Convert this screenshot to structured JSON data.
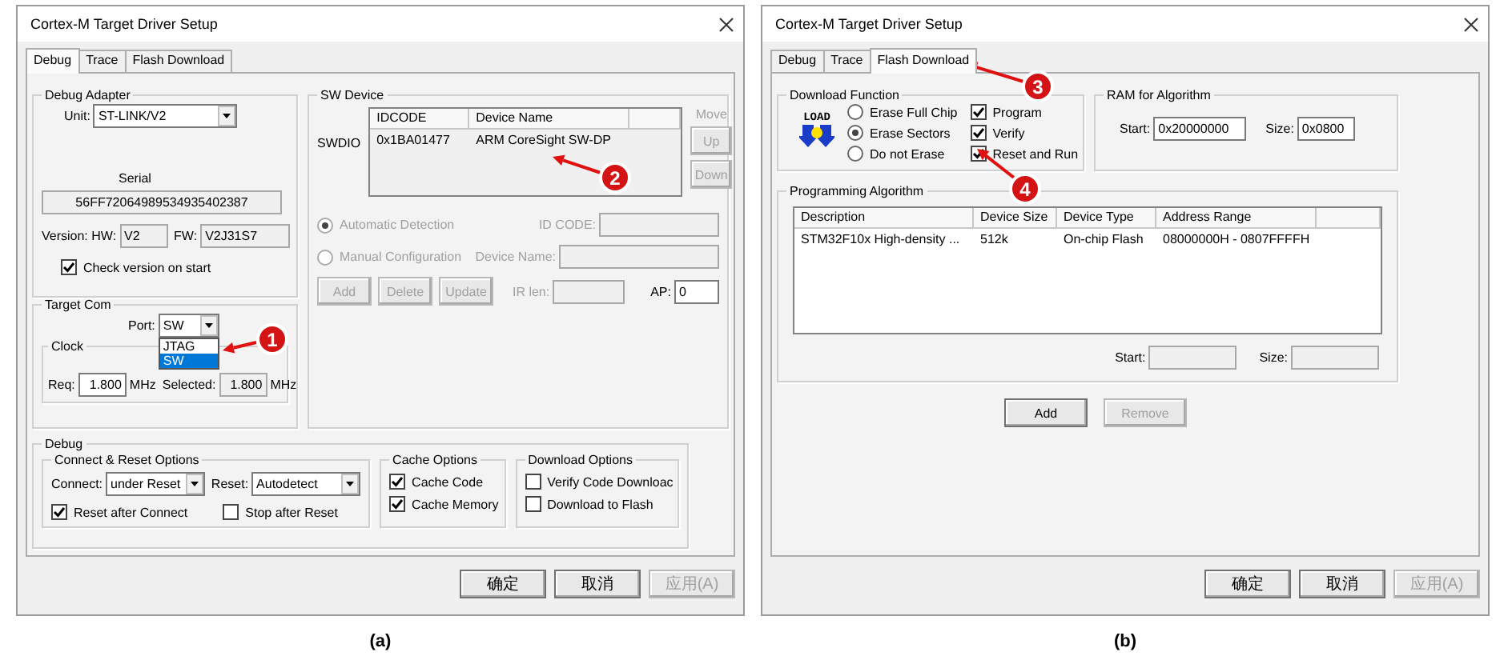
{
  "dialogs": [
    {
      "kind": "debug",
      "title": "Cortex-M Target Driver Setup",
      "caption": "(a)",
      "tabs": [
        {
          "label": "Debug",
          "selected": true
        },
        {
          "label": "Trace",
          "selected": false
        },
        {
          "label": "Flash Download",
          "selected": false
        }
      ],
      "debug_adapter": {
        "title": "Debug Adapter",
        "unit_label": "Unit:",
        "unit": "ST-LINK/V2",
        "serial_label": "Serial",
        "serial": {
          "value": "56FF72064989534935402387",
          "disabled": true
        },
        "version_label": "Version: HW:",
        "hw": {
          "value": "V2",
          "disabled": true
        },
        "fw_label": "FW:",
        "fw": {
          "value": "V2J31S7",
          "disabled": true
        },
        "check_version": {
          "label": "Check version on start",
          "checked": true
        }
      },
      "sw_device": {
        "title": "SW Device",
        "row_label": "SWDIO",
        "columns": [
          "IDCODE",
          "Device Name"
        ],
        "rows": [
          [
            "0x1BA01477",
            "ARM CoreSight SW-DP"
          ]
        ],
        "move_label": "Move",
        "move_buttons": [
          {
            "label": "Up",
            "disabled": true
          },
          {
            "label": "Down",
            "disabled": true
          }
        ],
        "modes": [
          {
            "label": "Automatic Detection",
            "selected": true,
            "disabled": true
          },
          {
            "label": "Manual Configuration",
            "selected": false,
            "disabled": true
          }
        ],
        "id_code": {
          "label": "ID CODE:",
          "disabled": true
        },
        "device_name": {
          "label": "Device Name:",
          "disabled": true
        },
        "buttons": [
          {
            "label": "Add",
            "disabled": true
          },
          {
            "label": "Delete",
            "disabled": true
          },
          {
            "label": "Update",
            "disabled": true
          }
        ],
        "ir_len": {
          "label": "IR len:",
          "disabled": true
        },
        "ap": {
          "label": "AP:",
          "value": "0",
          "disabled": false
        }
      },
      "target_com": {
        "title": "Target Com",
        "port_label": "Port:",
        "port": "SW",
        "port_options": [
          {
            "label": "JTAG",
            "selected": false
          },
          {
            "label": "SW",
            "selected": true
          }
        ],
        "clock": {
          "title": "Clock",
          "req_label": "Req:",
          "req": {
            "value": "1.800",
            "disabled": false
          },
          "req_unit": "MHz",
          "selected_label": "Selected:",
          "selected_clock": {
            "value": "1.800",
            "disabled": true
          },
          "selected_unit": "MHz"
        }
      },
      "debug": {
        "title": "Debug",
        "connect_reset": {
          "title": "Connect & Reset Options",
          "connect_label": "Connect:",
          "connect": "under Reset",
          "reset_label": "Reset:",
          "reset": "Autodetect",
          "options": [
            {
              "label": "Reset after Connect",
              "checked": true
            },
            {
              "label": "Stop after Reset",
              "checked": false
            }
          ]
        },
        "cache": {
          "title": "Cache Options",
          "options": [
            {
              "label": "Cache Code",
              "checked": true
            },
            {
              "label": "Cache Memory",
              "checked": true
            }
          ]
        },
        "download": {
          "title": "Download Options",
          "options": [
            {
              "label": "Verify Code Downloac",
              "checked": false
            },
            {
              "label": "Download to Flash",
              "checked": false
            }
          ]
        }
      },
      "buttons": [
        {
          "label": "确定",
          "disabled": false
        },
        {
          "label": "取消",
          "disabled": false
        },
        {
          "label": "应用(A)",
          "disabled": true
        }
      ]
    },
    {
      "kind": "flash",
      "title": "Cortex-M Target Driver Setup",
      "caption": "(b)",
      "tabs": [
        {
          "label": "Debug",
          "selected": false
        },
        {
          "label": "Trace",
          "selected": false
        },
        {
          "label": "Flash Download",
          "selected": true
        }
      ],
      "download_function": {
        "title": "Download Function",
        "icon_text": "LOAD",
        "erase": [
          {
            "label": "Erase Full Chip",
            "selected": false
          },
          {
            "label": "Erase Sectors",
            "selected": true
          },
          {
            "label": "Do not Erase",
            "selected": false
          }
        ],
        "options": [
          {
            "label": "Program",
            "checked": true
          },
          {
            "label": "Verify",
            "checked": true
          },
          {
            "label": "Reset and Run",
            "checked": true
          }
        ]
      },
      "ram": {
        "title": "RAM for Algorithm",
        "start_label": "Start:",
        "start": {
          "value": "0x20000000",
          "disabled": false
        },
        "size_label": "Size:",
        "size": {
          "value": "0x0800",
          "disabled": false
        }
      },
      "algorithm": {
        "title": "Programming Algorithm",
        "columns": [
          "Description",
          "Device Size",
          "Device Type",
          "Address Range"
        ],
        "rows": [
          [
            "STM32F10x High-density ...",
            "512k",
            "On-chip Flash",
            "08000000H - 0807FFFFH"
          ]
        ],
        "start_label": "Start:",
        "start": {
          "disabled": true
        },
        "size_label": "Size:",
        "size": {
          "disabled": true
        }
      },
      "list_buttons": [
        {
          "label": "Add",
          "disabled": false
        },
        {
          "label": "Remove",
          "disabled": true
        }
      ],
      "buttons": [
        {
          "label": "确定",
          "disabled": false
        },
        {
          "label": "取消",
          "disabled": false
        },
        {
          "label": "应用(A)",
          "disabled": true
        }
      ]
    }
  ],
  "annotations": [
    {
      "number": "1"
    },
    {
      "number": "2"
    },
    {
      "number": "3"
    },
    {
      "number": "4"
    }
  ]
}
